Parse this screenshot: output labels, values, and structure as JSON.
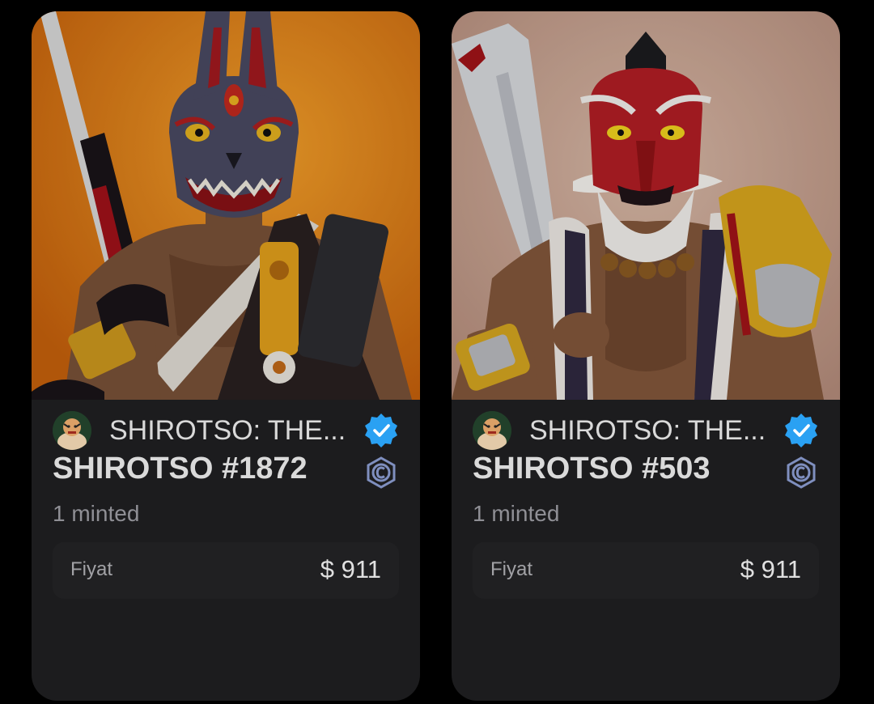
{
  "cards": [
    {
      "collection_name": "SHIROTSO: THE...",
      "title": "SHIROTSO #1872",
      "minted": "1 minted",
      "price_label": "Fiyat",
      "price_value": "$ 911",
      "art_subject": "fox-masked samurai with katana",
      "background_color": "#e08a1c"
    },
    {
      "collection_name": "SHIROTSO: THE...",
      "title": "SHIROTSO #503",
      "minted": "1 minted",
      "price_label": "Fiyat",
      "price_value": "$ 911",
      "art_subject": "tengu-masked warrior with cleaver",
      "background_color": "#c9a594"
    }
  ],
  "colors": {
    "card_background": "#1c1c1e",
    "verified_badge": "#2aa1f3",
    "chain_icon": "#7f8fbf"
  },
  "icons": {
    "verified": "verified-badge-icon",
    "chain": "chain-icon"
  }
}
